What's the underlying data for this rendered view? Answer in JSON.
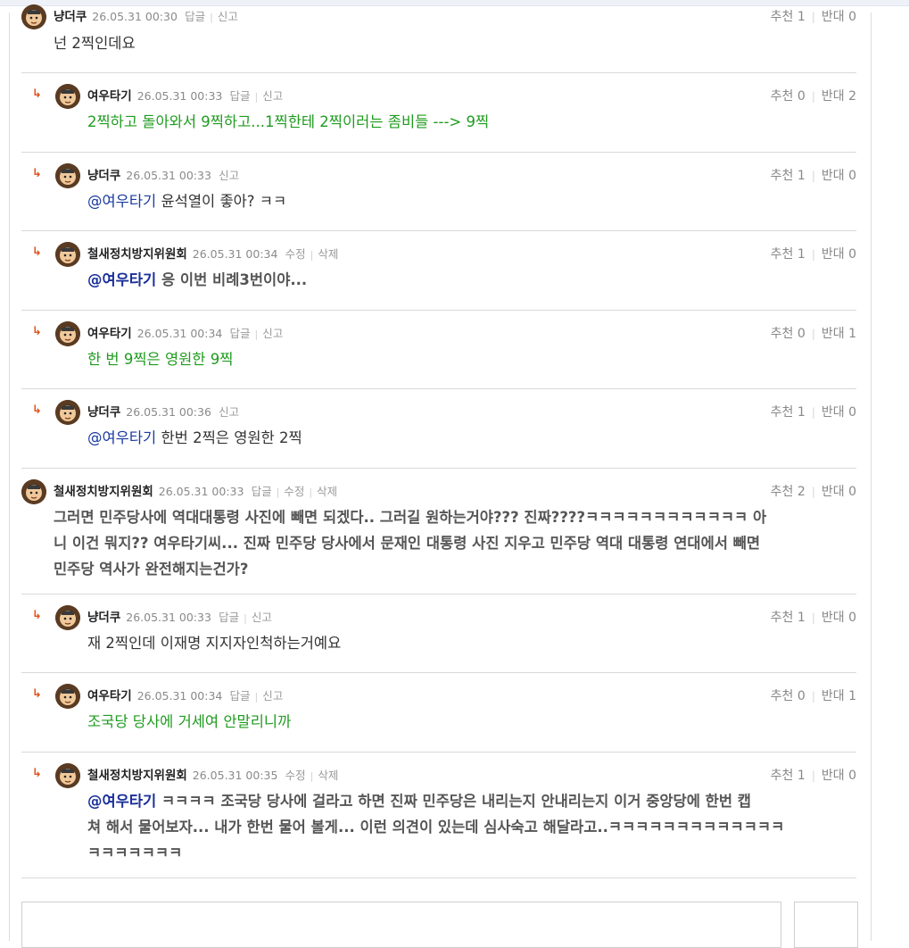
{
  "labels": {
    "reply": "답글",
    "report": "신고",
    "edit": "수정",
    "delete": "삭제",
    "recommend": "추천",
    "oppose": "반대"
  },
  "comments": [
    {
      "nick": "냥더쿠",
      "date": "26.05.31 00:30",
      "actions": [
        "답글",
        "신고"
      ],
      "up": "1",
      "down": "0",
      "lines": [
        "넌 2찍인데요"
      ],
      "style": "normal",
      "mention": ""
    },
    {
      "nick": "여우타기",
      "date": "26.05.31 00:33",
      "actions": [
        "답글",
        "신고"
      ],
      "up": "0",
      "down": "2",
      "lines": [
        "2찍하고 돌아와서 9찍하고...1찍한테 2찍이러는 좀비들 ---> 9찍"
      ],
      "style": "green",
      "mention": ""
    },
    {
      "nick": "냥더쿠",
      "date": "26.05.31 00:33",
      "actions": [
        "신고"
      ],
      "up": "1",
      "down": "0",
      "lines": [
        "윤석열이 좋아? ㅋㅋ"
      ],
      "style": "normal",
      "mention": "@여우타기"
    },
    {
      "nick": "철새정치방지위원회",
      "date": "26.05.31 00:34",
      "actions": [
        "수정",
        "삭제"
      ],
      "up": "1",
      "down": "0",
      "lines": [
        "응 이번 비례3번이야..."
      ],
      "style": "bold",
      "mention": "@여우타기"
    },
    {
      "nick": "여우타기",
      "date": "26.05.31 00:34",
      "actions": [
        "답글",
        "신고"
      ],
      "up": "0",
      "down": "1",
      "lines": [
        "한 번 9찍은 영원한 9찍"
      ],
      "style": "green",
      "mention": ""
    },
    {
      "nick": "냥더쿠",
      "date": "26.05.31 00:36",
      "actions": [
        "신고"
      ],
      "up": "1",
      "down": "0",
      "lines": [
        "한번 2찍은 영원한 2찍"
      ],
      "style": "normal",
      "mention": "@여우타기"
    },
    {
      "nick": "철새정치방지위원회",
      "date": "26.05.31 00:33",
      "actions": [
        "답글",
        "수정",
        "삭제"
      ],
      "up": "2",
      "down": "0",
      "lines": [
        "그러면 민주당사에 역대대통령 사진에 빼면 되겠다.. 그러길 원하는거야??? 진짜????ㅋㅋㅋㅋㅋㅋㅋㅋㅋㅋㅋㅋ 아",
        "니 이건 뭐지?? 여우타기씨... 진짜 민주당 당사에서 문재인 대통령 사진 지우고 민주당 역대 대통령 연대에서 빼면",
        "민주당 역사가 완전해지는건가?"
      ],
      "style": "bold",
      "mention": ""
    },
    {
      "nick": "냥더쿠",
      "date": "26.05.31 00:33",
      "actions": [
        "답글",
        "신고"
      ],
      "up": "1",
      "down": "0",
      "lines": [
        "재 2찍인데 이재명 지지자인척하는거예요"
      ],
      "style": "normal",
      "mention": ""
    },
    {
      "nick": "여우타기",
      "date": "26.05.31 00:34",
      "actions": [
        "답글",
        "신고"
      ],
      "up": "0",
      "down": "1",
      "lines": [
        "조국당 당사에 거세여 안말리니까"
      ],
      "style": "green",
      "mention": ""
    },
    {
      "nick": "철새정치방지위원회",
      "date": "26.05.31 00:35",
      "actions": [
        "수정",
        "삭제"
      ],
      "up": "1",
      "down": "0",
      "lines": [
        "ㅋㅋㅋㅋ 조국당 당사에 걸라고 하면 진짜 민주당은 내리는지 안내리는지 이거 중앙당에 한번 캡",
        "쳐 해서 물어보자... 내가 한번 물어 볼게... 이런 의견이 있는데 심사숙고 해달라고..ㅋㅋㅋㅋㅋㅋㅋㅋㅋㅋㅋㅋㅋ",
        "ㅋㅋㅋㅋㅋㅋㅋ"
      ],
      "style": "bold",
      "mention": "@여우타기"
    }
  ]
}
